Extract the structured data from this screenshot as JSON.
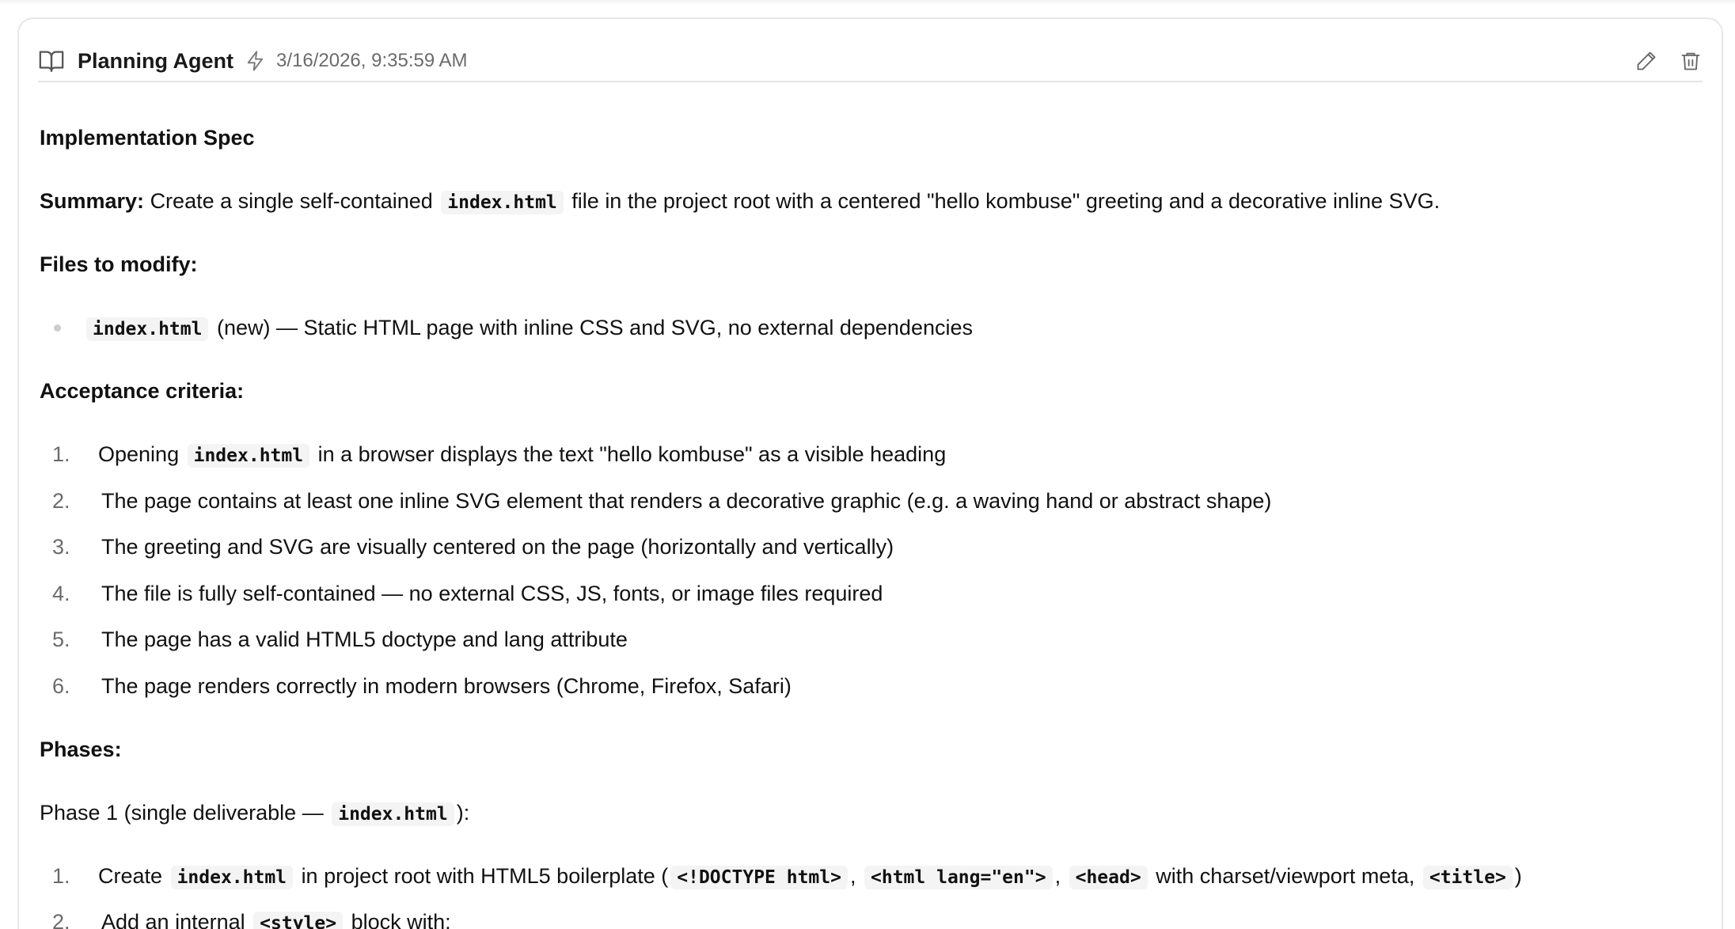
{
  "header": {
    "agent_name": "Planning Agent",
    "timestamp": "3/16/2026, 9:35:59 AM",
    "icons": [
      "book-icon",
      "bolt-icon",
      "pencil-icon",
      "trash-icon"
    ]
  },
  "doc": {
    "title": "Implementation Spec",
    "summary_label": "Summary:",
    "summary_pre": "Create a single self-contained",
    "summary_code": "index.html",
    "summary_post": "file in the project root with a centered \"hello kombuse\" greeting and a decorative inline SVG.",
    "files_heading": "Files to modify:",
    "files": [
      {
        "code": "index.html",
        "text": "(new) — Static HTML page with inline CSS and SVG, no external dependencies"
      }
    ],
    "acceptance_heading": "Acceptance criteria:",
    "criteria": [
      {
        "num": "1.",
        "pre": "Opening",
        "code": "index.html",
        "post": "in a browser displays the text \"hello kombuse\" as a visible heading"
      },
      {
        "num": "2.",
        "text": "The page contains at least one inline SVG element that renders a decorative graphic (e.g. a waving hand or abstract shape)"
      },
      {
        "num": "3.",
        "text": "The greeting and SVG are visually centered on the page (horizontally and vertically)"
      },
      {
        "num": "4.",
        "text": "The file is fully self-contained — no external CSS, JS, fonts, or image files required"
      },
      {
        "num": "5.",
        "text": "The page has a valid HTML5 doctype and lang attribute"
      },
      {
        "num": "6.",
        "text": "The page renders correctly in modern browsers (Chrome, Firefox, Safari)"
      }
    ],
    "phases_heading": "Phases:",
    "phase1": {
      "pre": "Phase 1 (single deliverable —",
      "code": "index.html",
      "post": "):"
    },
    "phase_steps": [
      {
        "num": "1.",
        "t1": "Create",
        "c1": "index.html",
        "t2": "in project root with HTML5 boilerplate (",
        "c2": "<!DOCTYPE html>",
        "t3": ",",
        "c3": "<html lang=\"en\">",
        "t4": ",",
        "c4": "<head>",
        "t5": "with charset/viewport meta,",
        "c5": "<title>",
        "t6": ")"
      },
      {
        "num": "2.",
        "t1": "Add an internal",
        "c1": "<style>",
        "t2": "block with:"
      }
    ]
  }
}
